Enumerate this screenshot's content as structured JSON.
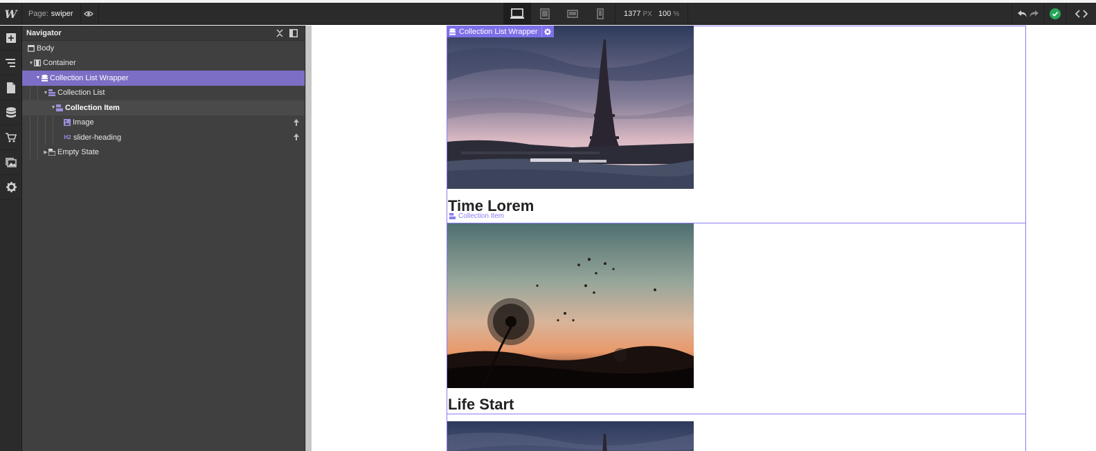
{
  "topbar": {
    "page_key": "Page:",
    "page_name": "swiper",
    "width_value": "1377",
    "width_unit": "PX",
    "zoom_value": "100",
    "zoom_unit": "%"
  },
  "navigator": {
    "title": "Navigator",
    "nodes": [
      {
        "label": "Body"
      },
      {
        "label": "Container"
      },
      {
        "label": "Collection List Wrapper"
      },
      {
        "label": "Collection List"
      },
      {
        "label": "Collection Item"
      },
      {
        "label": "Image"
      },
      {
        "label": "slider-heading",
        "tag": "H2"
      },
      {
        "label": "Empty State"
      }
    ]
  },
  "canvas": {
    "wrapper_badge": "Collection List Wrapper",
    "item_label": "Collection Item",
    "slides": [
      {
        "heading": "Time Lorem",
        "image": "eiffel-tower-photo"
      },
      {
        "heading": "Life Start",
        "image": "dandelion-sunset-photo"
      },
      {
        "heading": "",
        "image": "eiffel-tower-photo"
      }
    ]
  },
  "colors": {
    "selection": "#7b6ec4",
    "outline": "#8a7cf3",
    "panel": "#404040",
    "toolbar": "#2b2b2b",
    "publish_ok": "#27a55a"
  }
}
